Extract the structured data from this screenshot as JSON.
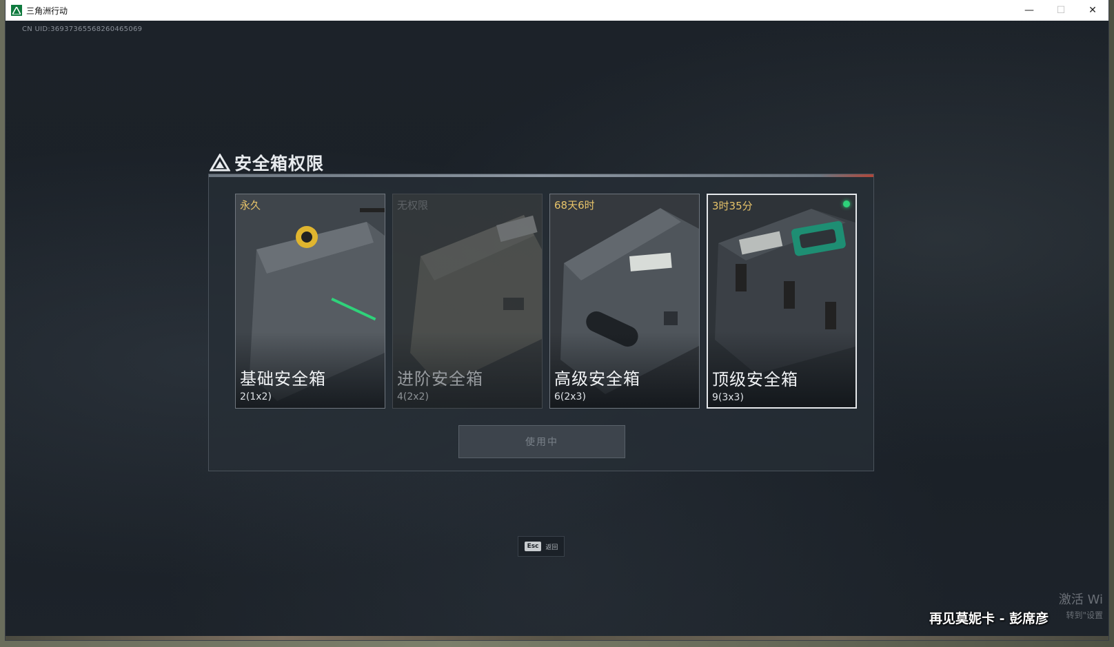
{
  "window": {
    "title": "三角洲行动",
    "controls": {
      "minimize": "—",
      "maximize": "☐",
      "close": "✕"
    }
  },
  "uid": "CN UID:369373655682604650​69",
  "panel": {
    "title": "安全箱权限",
    "cards": [
      {
        "duration": "永久",
        "name": "基础安全箱",
        "capacity": "2(1x2)",
        "state": "available"
      },
      {
        "duration": "无权限",
        "name": "进阶安全箱",
        "capacity": "4(2x2)",
        "state": "locked"
      },
      {
        "duration": "68天6时",
        "name": "高级安全箱",
        "capacity": "6(2x3)",
        "state": "available"
      },
      {
        "duration": "3时35分",
        "name": "顶级安全箱",
        "capacity": "9(3x3)",
        "state": "selected-active"
      }
    ],
    "use_button": "使用中"
  },
  "esc_hint": {
    "key": "Esc",
    "label": "返回"
  },
  "watermark": {
    "line1": "激活 Wi",
    "line2": "转到\"设置"
  },
  "song_caption": "再见莫妮卡 - 彭席彦",
  "colors": {
    "accent_gold": "#e8c46a",
    "active_green": "#2ed37a",
    "brand_green": "#0f7a3e"
  }
}
